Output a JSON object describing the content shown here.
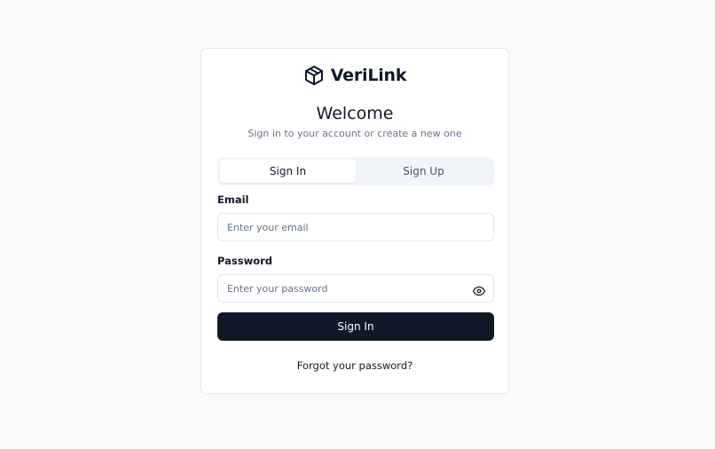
{
  "brand": {
    "name": "VeriLink",
    "logo_icon": "box-icon"
  },
  "header": {
    "title": "Welcome",
    "subtitle": "Sign in to your account or create a new one"
  },
  "tabs": [
    {
      "label": "Sign In",
      "active": true
    },
    {
      "label": "Sign Up",
      "active": false
    }
  ],
  "form": {
    "email_label": "Email",
    "email_placeholder": "Enter your email",
    "email_value": "",
    "password_label": "Password",
    "password_placeholder": "Enter your password",
    "password_value": "",
    "password_toggle_icon": "eye-icon",
    "submit_label": "Sign In",
    "forgot_label": "Forgot your password?"
  },
  "colors": {
    "background": "#f8fafc",
    "primary": "#111827",
    "border": "#e2e8f0",
    "muted_text": "#64748b"
  }
}
